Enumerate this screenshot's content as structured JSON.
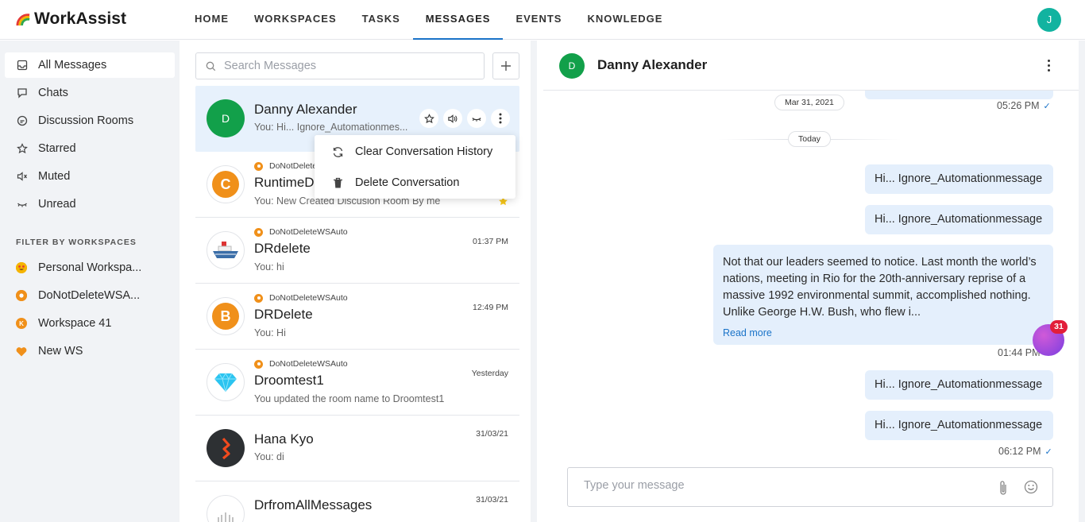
{
  "app": {
    "name": "WorkAssist",
    "user_initial": "J"
  },
  "nav": {
    "items": [
      "HOME",
      "WORKSPACES",
      "TASKS",
      "MESSAGES",
      "EVENTS",
      "KNOWLEDGE"
    ],
    "active": "MESSAGES"
  },
  "sidebar": {
    "items": [
      {
        "label": "All Messages",
        "icon": "inbox-icon",
        "active": true
      },
      {
        "label": "Chats",
        "icon": "chat-bubble-icon"
      },
      {
        "label": "Discussion Rooms",
        "icon": "discussion-icon"
      },
      {
        "label": "Starred",
        "icon": "star-icon"
      },
      {
        "label": "Muted",
        "icon": "mute-icon"
      },
      {
        "label": "Unread",
        "icon": "eye-closed-icon"
      }
    ],
    "filter_header": "FILTER BY WORKSPACES",
    "workspaces": [
      {
        "label": "Personal Workspa...",
        "color": "#f5b400",
        "icon": "emoji-face-icon"
      },
      {
        "label": "DoNotDeleteWSA...",
        "color": "#f0901a",
        "icon": "ring-icon"
      },
      {
        "label": "Workspace 41",
        "color": "#f0901a",
        "letter": "K"
      },
      {
        "label": "New WS",
        "color": "#f0901a",
        "icon": "heart-icon"
      }
    ]
  },
  "list": {
    "search_placeholder": "Search Messages",
    "conversations": [
      {
        "name": "Danny Alexander",
        "preview": "You: Hi... Ignore_Automationmes...",
        "avatar_letter": "D",
        "avatar_color": "#12a04a",
        "active": true
      },
      {
        "workspace": "DoNotDeleteWSAuto",
        "name": "RuntimeDr",
        "preview": "You: New Created Discusion Room By me",
        "avatar_letter": "C",
        "avatar_color": "#f0901a",
        "starred": true
      },
      {
        "workspace": "DoNotDeleteWSAuto",
        "name": "DRdelete",
        "preview": "You: hi",
        "time": "01:37 PM",
        "avatar_icon": "ship-icon"
      },
      {
        "workspace": "DoNotDeleteWSAuto",
        "name": "DRDelete",
        "preview": "You: Hi",
        "time": "12:49 PM",
        "avatar_letter": "B",
        "avatar_color": "#f0901a"
      },
      {
        "workspace": "DoNotDeleteWSAuto",
        "name": "Droomtest1",
        "preview": "You updated the room name to Droomtest1",
        "time": "Yesterday",
        "avatar_icon": "diamond-icon"
      },
      {
        "name": "Hana Kyo",
        "preview": "You: di",
        "time": "31/03/21",
        "avatar_icon": "bolt-logo-icon"
      },
      {
        "name": "DrfromAllMessages",
        "preview": "",
        "time": "31/03/21",
        "avatar_icon": "group-icon"
      }
    ],
    "context_menu": [
      "Clear Conversation History",
      "Delete Conversation"
    ]
  },
  "chat": {
    "contact": "Danny Alexander",
    "contact_initial": "D",
    "date_old": "Mar 31, 2021",
    "time_old": "05:26 PM",
    "date_today": "Today",
    "messages": [
      {
        "text": "Hi... Ignore_Automationmessage"
      },
      {
        "text": "Hi... Ignore_Automationmessage"
      },
      {
        "text": "Not that our leaders seemed to notice. Last month the world’s nations, meeting in Rio for the 20th-anniversary reprise of a massive 1992 environmental summit, accomplished nothing. Unlike George H.W. Bush, who flew i...",
        "read_more": "Read more"
      },
      {
        "text": "Hi... Ignore_Automationmessage"
      },
      {
        "text": "Hi... Ignore_Automationmessage"
      }
    ],
    "time_mid": "01:44 PM",
    "time_last": "06:12 PM",
    "composer_placeholder": "Type your message"
  },
  "fab": {
    "badge": "31"
  },
  "colors": {
    "accent": "#1a73c8",
    "bubble": "#e4effc",
    "sidebar_bg": "#f1f3f6",
    "active_row": "#e7f1fc",
    "badge": "#e21e3a"
  }
}
